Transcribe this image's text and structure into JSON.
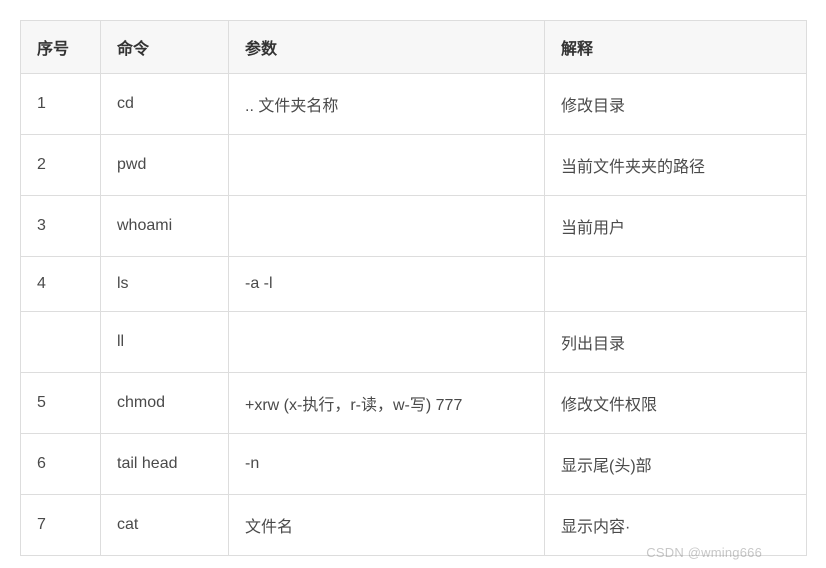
{
  "chart_data": {
    "type": "table",
    "headers": [
      "序号",
      "命令",
      "参数",
      "解释"
    ],
    "rows": [
      [
        "1",
        "cd",
        ".. 文件夹名称",
        "修改目录"
      ],
      [
        "2",
        "pwd",
        "",
        "当前文件夹夹的路径"
      ],
      [
        "3",
        "whoami",
        "",
        "当前用户"
      ],
      [
        "4",
        "ls",
        "-a -l",
        ""
      ],
      [
        "",
        "ll",
        "",
        "列出目录"
      ],
      [
        "5",
        "chmod",
        "+xrw (x-执行，r-读，w-写) 777",
        "修改文件权限"
      ],
      [
        "6",
        "tail head",
        "-n",
        "显示尾(头)部"
      ],
      [
        "7",
        "cat",
        "文件名",
        "显示内容·"
      ]
    ]
  },
  "watermark": "CSDN @wming666"
}
